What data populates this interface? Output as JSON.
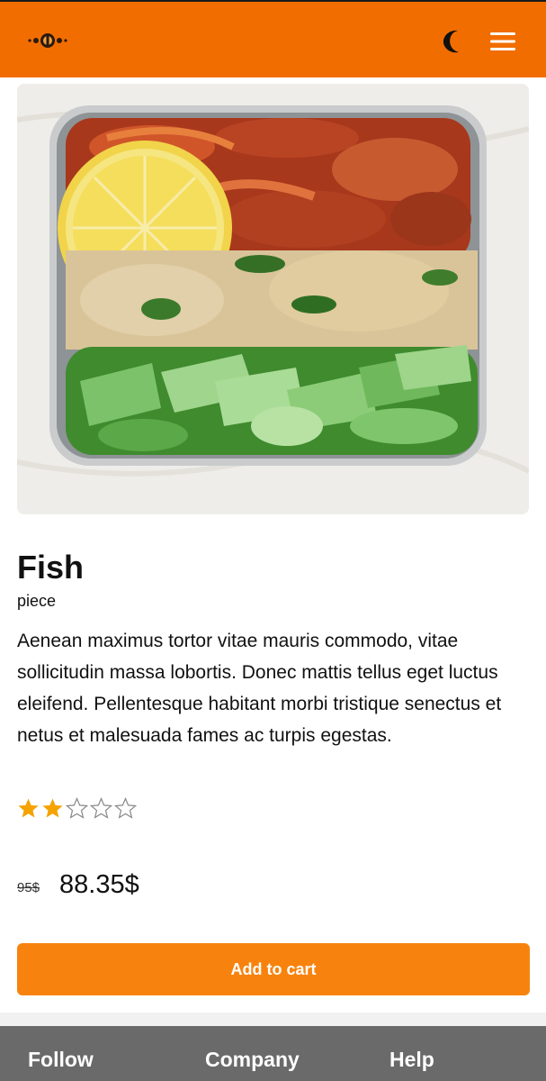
{
  "header": {
    "logo_icon": "restaurant-logo",
    "theme_icon": "moon-icon",
    "menu_icon": "hamburger-menu-icon",
    "background_color": "#f26d00"
  },
  "product": {
    "image": "lunch-box-salad-photo",
    "title": "Fish",
    "unit": "piece",
    "description": "Aenean maximus tortor vitae mauris commodo, vitae sollicitudin massa lobortis. Donec mattis tellus eget luctus eleifend. Pellentesque habitant morbi tristique senectus et netus et malesuada fames ac turpis egestas.",
    "rating": 2,
    "rating_max": 5,
    "star_color": "#f5a300",
    "old_price": "95$",
    "price": "88.35$",
    "add_to_cart_label": "Add to cart",
    "button_color": "#f7830e"
  },
  "footer": {
    "links": [
      "Follow",
      "Company",
      "Help"
    ],
    "background_color": "#6a6a6a"
  }
}
